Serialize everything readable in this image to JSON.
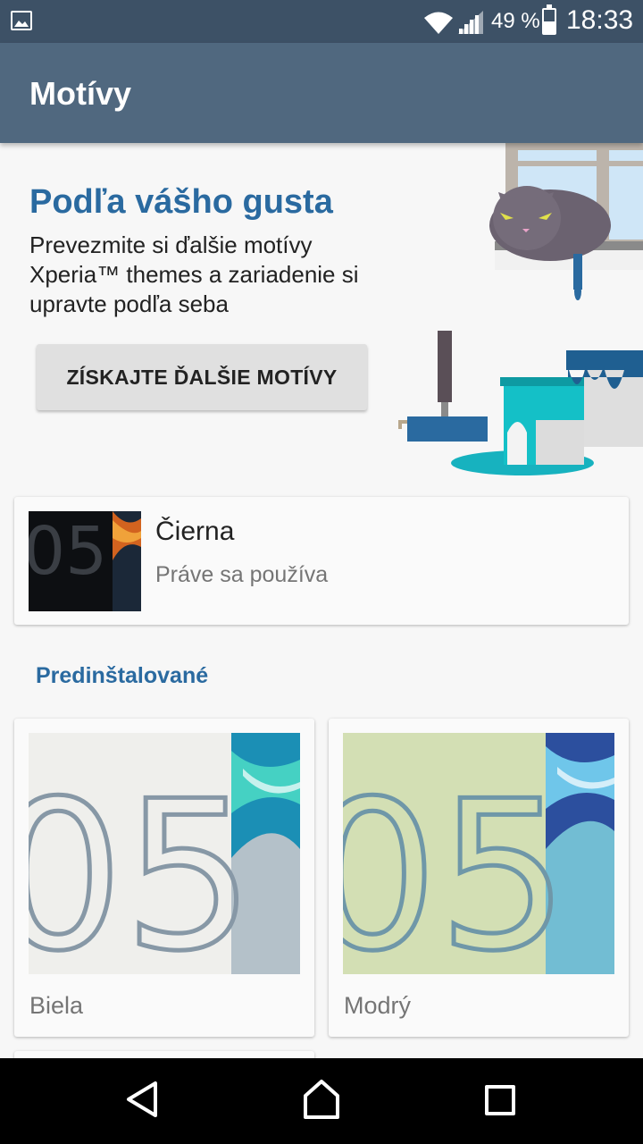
{
  "status_bar": {
    "notification_icon": "image-icon",
    "wifi_icon": "wifi-icon",
    "signal_icon": "cell-signal-icon",
    "battery_percent": "49 %",
    "battery_level": 0.49,
    "time": "18:33"
  },
  "app_bar": {
    "title": "Motívy"
  },
  "promo": {
    "title": "Podľa vášho gusta",
    "text": "Prevezmite si ďalšie motívy Xperia™ themes a zariadenie si upravte podľa seba",
    "button_label": "ZÍSKAJTE ĎALŠIE MOTÍVY",
    "illustration": "cat-and-paint-illustration"
  },
  "current_theme": {
    "name": "Čierna",
    "status": "Práve sa používa"
  },
  "preinstalled": {
    "header": "Predinštalované",
    "themes": [
      {
        "name": "Biela"
      },
      {
        "name": "Modrý"
      }
    ]
  },
  "nav": {
    "back_icon": "back-triangle-icon",
    "home_icon": "home-icon",
    "recents_icon": "recents-square-icon"
  },
  "colors": {
    "status_bar": "#3d5166",
    "app_bar": "#50687f",
    "accent": "#2a6aa0",
    "background": "#f7f7f7"
  }
}
